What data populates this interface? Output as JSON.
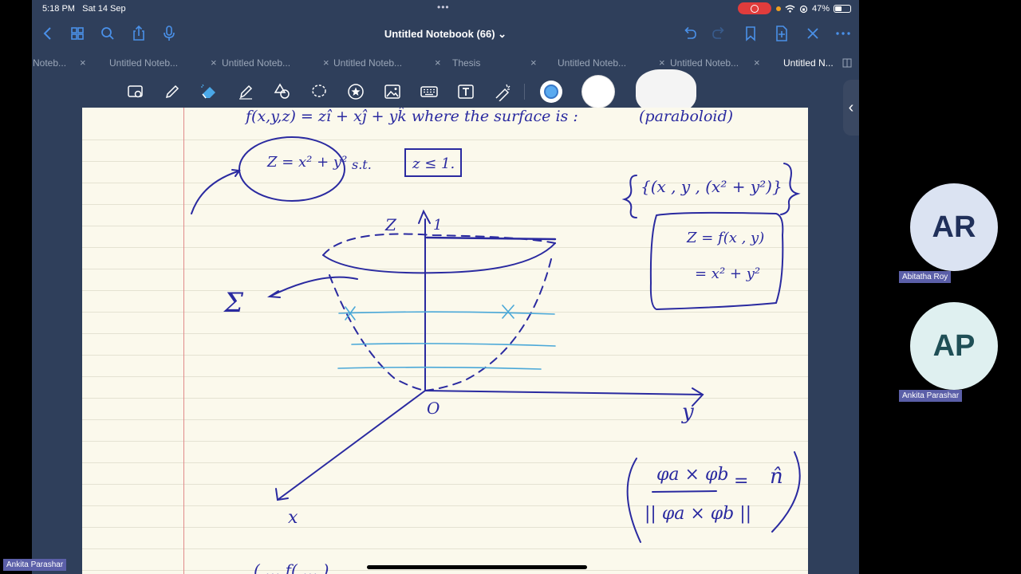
{
  "status": {
    "time": "5:18 PM",
    "date": "Sat 14 Sep",
    "battery": "47%",
    "battery_level": 0.47
  },
  "nav": {
    "title": "Untitled Notebook (66) ⌄"
  },
  "tabs": [
    {
      "label": "Noteb..."
    },
    {
      "label": "Untitled Noteb..."
    },
    {
      "label": "Untitled Noteb..."
    },
    {
      "label": "Untitled Noteb..."
    },
    {
      "label": "Thesis"
    },
    {
      "label": "Untitled Noteb..."
    },
    {
      "label": "Untitled Noteb..."
    },
    {
      "label": "Untitled N..."
    }
  ],
  "tab_close": "×",
  "notes": {
    "line1": "f(x,y,z) = zî + xĵ + yk̂  where  the  surface  is :",
    "line1_paren": "(paraboloid)",
    "eq_circle": "Z = x² + y²",
    "st": "s.t.",
    "box": "z ≤ 1.",
    "set": "{(x , y , (x² + y²)}",
    "box2_l1": "Z = f(x , y)",
    "box2_l2": "= x² + y²",
    "axis_z": "Z",
    "one": "1",
    "sigma": "Σ",
    "origin": "O",
    "axis_y": "y",
    "axis_x": "x",
    "frac_num": "φa × φb",
    "frac_den": "|| φa × φb ||",
    "frac_eq": "=",
    "n_hat": "n̂",
    "bottom_partial": "( ...      f( ... )"
  },
  "participants": [
    {
      "initials": "AR",
      "name": "Abitatha Roy",
      "bg": "#dbe3f2",
      "fg": "#20305a"
    },
    {
      "initials": "AP",
      "name": "Ankita Parashar",
      "bg": "#dff0f0",
      "fg": "#1f4f56"
    }
  ],
  "self_label": "Ankita Parashar",
  "colors": {
    "ink": "#2a2aa0",
    "cyan": "#4aa8d8",
    "accent": "#4a90e8"
  }
}
